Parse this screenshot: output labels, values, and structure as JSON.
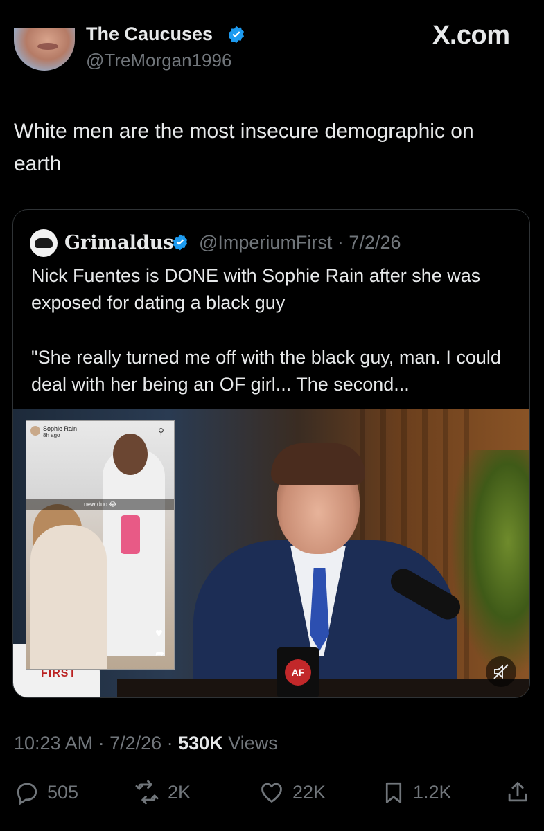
{
  "header": {
    "display_name": "The Caucuses",
    "handle": "@TreMorgan1996",
    "brand": "X.com"
  },
  "tweet": {
    "text": "White men are the most insecure demographic on earth"
  },
  "quoted": {
    "display_name": "Grimaldus",
    "handle": "@ImperiumFirst",
    "date": "7/2/26",
    "text": "Nick Fuentes is DONE with Sophie Rain after she was exposed for dating a black guy",
    "text2": "\"She really turned me off with the black guy, man. I could deal with her being an OF girl... The second...",
    "media": {
      "inset_user": "Sophie Rain",
      "inset_time": "8h ago",
      "inset_caption": "new duo 😂",
      "hat_text": "FIRST",
      "mug_text": "AF"
    }
  },
  "meta": {
    "time": "10:23 AM",
    "date": "7/2/26",
    "views_count": "530K",
    "views_label": "Views"
  },
  "actions": {
    "replies": "505",
    "reposts": "2K",
    "likes": "22K",
    "bookmarks": "1.2K"
  },
  "colors": {
    "background": "#000000",
    "text": "#e7e9ea",
    "secondary": "#71767b",
    "verified": "#1d9bf0",
    "border": "#2f3336"
  },
  "icons": [
    "verified-badge-icon",
    "reply-icon",
    "repost-icon",
    "like-icon",
    "bookmark-icon",
    "share-icon",
    "mute-icon"
  ]
}
